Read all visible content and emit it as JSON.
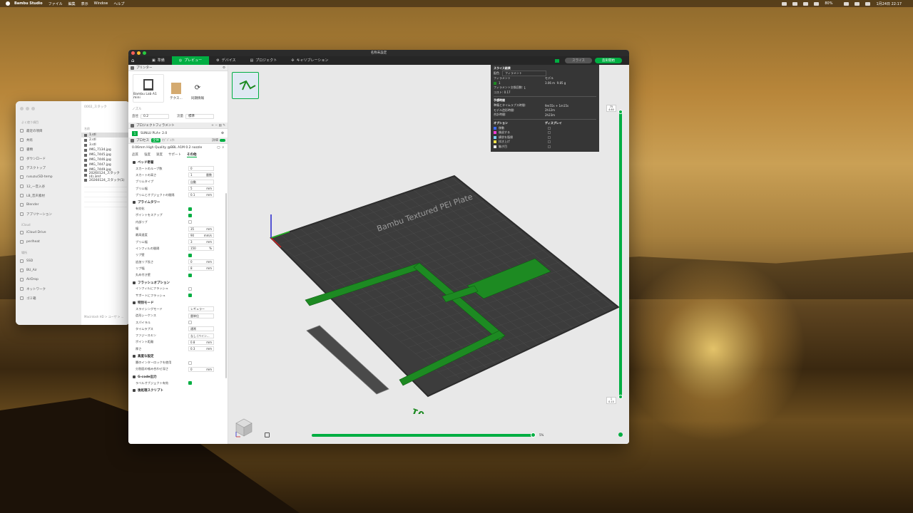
{
  "menubar": {
    "app": "Bambu Studio",
    "items": [
      "ファイル",
      "編集",
      "表示",
      "Window",
      "ヘルプ"
    ],
    "battery": "80%",
    "clock": "1月24日 22:17"
  },
  "finder": {
    "path_title": "0002_スタック",
    "sections": {
      "favorites": "よく使う項目",
      "icloud": "iCloud",
      "locations": "場所"
    },
    "sidebar": [
      "最近の項目",
      "共有",
      "書類",
      "ダウンロード",
      "デスクトップ",
      "rusuzu(SD-temp",
      "12_一音入谷",
      "LB_音声素材",
      "Blender",
      "アプリケーション"
    ],
    "sidebar_cloud": [
      "iCloud Drive",
      "perlheat"
    ],
    "sidebar_loc": [
      "SSD",
      "BU_Air",
      "AirDrop",
      "ネットワーク",
      "ゴミ箱"
    ],
    "column_header": "名前",
    "files": [
      "1.stl",
      "2.stl",
      "3.stl",
      "IMG_7134.jpg",
      "IMG_7445.jpg",
      "IMG_7446.jpg",
      "IMG_7447.jpg",
      "IMG_7449.jpg",
      "20260124_スタック(4).3mf",
      "20260124_スタック(1)"
    ],
    "selected_index": 0,
    "path_bar": "Macintosh HD > ユーザ > ..."
  },
  "window": {
    "title": "名称未設定",
    "tabs": [
      "準備",
      "プレビュー",
      "デバイス",
      "プロジェクト",
      "キャリブレーション"
    ],
    "active_tab": 1,
    "slice_btn": "スライス",
    "print_btn": "造形開始"
  },
  "printer_panel": {
    "header": "プリンター",
    "printer_name": "Bambu Lab A1 mini",
    "plate_name": "テクス...",
    "sync_label": "同期情報",
    "nozzle_title": "ノズル",
    "diameter_label": "直径",
    "diameter_value": "0.2",
    "flow_label": "流量",
    "flow_value": "標準"
  },
  "filament_panel": {
    "header": "プロジェクトフィラメント",
    "slot": "1",
    "name": "SUNLU PLA+ 2.0"
  },
  "process_panel": {
    "header": "プロセス",
    "global_label": "全体",
    "object_label": "ｵﾌﾞｼﾞｪｸﾄ",
    "advanced_label": "詳細",
    "profile": "0.06mm High Quality @BBL A1M 0.2 nozzle",
    "tabs": [
      "品質",
      "強度",
      "速度",
      "サポート",
      "その他"
    ],
    "active_tab": 4
  },
  "settings": {
    "bed_adhesion": {
      "title": "ベッド密着",
      "rows": [
        {
          "label": "スカートのループ数",
          "value": "0",
          "unit": ""
        },
        {
          "label": "スカートの高さ",
          "value": "1",
          "unit": "層数"
        },
        {
          "label": "ブリムタイプ",
          "value": "自動",
          "unit": ""
        },
        {
          "label": "ブリム幅",
          "value": "5",
          "unit": "mm"
        },
        {
          "label": "ブリムとオブジェクトの間隔",
          "value": "0.1",
          "unit": "mm"
        }
      ]
    },
    "prime_tower": {
      "title": "プライムタワー",
      "rows": [
        {
          "label": "有効化",
          "check": true
        },
        {
          "label": "ポイントをスナップ",
          "check": true
        },
        {
          "label": "内部リブ",
          "check": false
        },
        {
          "label": "幅",
          "value": "35",
          "unit": "mm"
        },
        {
          "label": "最高速度",
          "value": "90",
          "unit": "mm/s"
        },
        {
          "label": "ブリム幅",
          "value": "3",
          "unit": "mm"
        },
        {
          "label": "インフィルの間隔",
          "value": "150",
          "unit": "%"
        },
        {
          "label": "リブ壁",
          "check": true
        },
        {
          "label": "追加リブ長さ",
          "value": "0",
          "unit": "mm"
        },
        {
          "label": "リブ幅",
          "value": "8",
          "unit": "mm"
        },
        {
          "label": "丸め付き壁",
          "check": true
        }
      ]
    },
    "flush": {
      "title": "フラッシュオプション",
      "rows": [
        {
          "label": "インフィルにフラッシュ",
          "check": false
        },
        {
          "label": "サポートにフラッシュ",
          "check": true
        }
      ]
    },
    "special_mode": {
      "title": "特別モード",
      "rows": [
        {
          "label": "スライシングモード",
          "value": "レギュラー",
          "unit": ""
        },
        {
          "label": "造形シーケンス",
          "value": "層単位",
          "unit": ""
        },
        {
          "label": "スパイラル",
          "check": false
        },
        {
          "label": "タイムラプス",
          "value": "通常",
          "unit": ""
        },
        {
          "label": "ファジースキン",
          "value": "なし (ペイン...",
          "unit": ""
        },
        {
          "label": "ポイント距離",
          "value": "0.8",
          "unit": "mm"
        },
        {
          "label": "厚さ",
          "value": "0.3",
          "unit": "mm"
        }
      ]
    },
    "advanced": {
      "title": "高度な設定",
      "rows": [
        {
          "label": "層のインターロックを使用",
          "check": false
        },
        {
          "label": "分割面の噛み合わせ深さ",
          "value": "0",
          "unit": "mm"
        }
      ]
    },
    "gcode_output": {
      "title": "G-code出力",
      "rows": [
        {
          "label": "ラベルオブジェクト有効",
          "check": true
        }
      ]
    },
    "post_script": {
      "title": "後処理スクリプト"
    }
  },
  "stats": {
    "title": "スライス結果",
    "color_label": "配色",
    "color_value": "フィラメント",
    "col_filament": "フィラメント",
    "col_model": "モデル",
    "filament_id": "1",
    "filament_usage": "3.06 m",
    "filament_weight": "9.85 g",
    "change_label": "フィラメント交換回数:",
    "change_value": "1",
    "cost_label": "コスト:",
    "cost_value": "0.17",
    "time_title": "予想時間",
    "time_rows": [
      {
        "label": "準備とタイムラプス時間:",
        "value": "9m55s + 1m15s"
      },
      {
        "label": "モデル造形時間:",
        "value": "2h12m"
      },
      {
        "label": "合計時間:",
        "value": "2h23m"
      }
    ],
    "opt_header": "オプション",
    "disp_header": "ディスプレイ",
    "options": [
      {
        "label": "移動",
        "color": "#3d6bf5"
      },
      {
        "label": "後退する",
        "color": "#f53dd6"
      },
      {
        "label": "横状を復帰",
        "color": "#7ed0f2"
      },
      {
        "label": "拭き上げ",
        "color": "#f2e24a"
      },
      {
        "label": "継ぎ目",
        "color": "#e8e8e8"
      }
    ]
  },
  "sliders": {
    "top_layer": "75",
    "top_height": "4.60",
    "bottom_layer": "1",
    "bottom_height": "0.10",
    "progress": "5%"
  },
  "bed": {
    "plate_label": "Bambu Textured PEI Plate",
    "plate_number": "01"
  },
  "colors": {
    "accent": "#00ae42",
    "model": "#1d8a22",
    "plate": "#3c3c3c"
  }
}
